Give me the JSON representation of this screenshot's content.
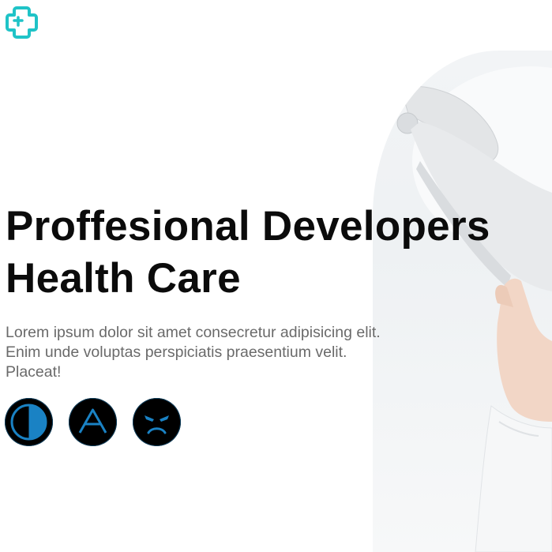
{
  "brand": {
    "logo_icon": "medical-cross-icon",
    "accent_color": "#1fc3c7"
  },
  "hero": {
    "headline_line1": "Proffesional Developers",
    "headline_line2": "Health Care",
    "description_line1": "Lorem ipsum dolor sit amet consecretur adipisicing elit.",
    "description_line2": "Enim unde voluptas perspiciatis praesentium velit.",
    "description_line3": "Placeat!",
    "image": "dental-chair-and-hand-photo"
  },
  "icon_buttons": [
    {
      "icon": "half-contrast-icon",
      "color": "#1a82c4"
    },
    {
      "icon": "letter-a-icon",
      "color": "#1a82c4"
    },
    {
      "icon": "angry-face-icon",
      "color": "#1a82c4"
    }
  ]
}
